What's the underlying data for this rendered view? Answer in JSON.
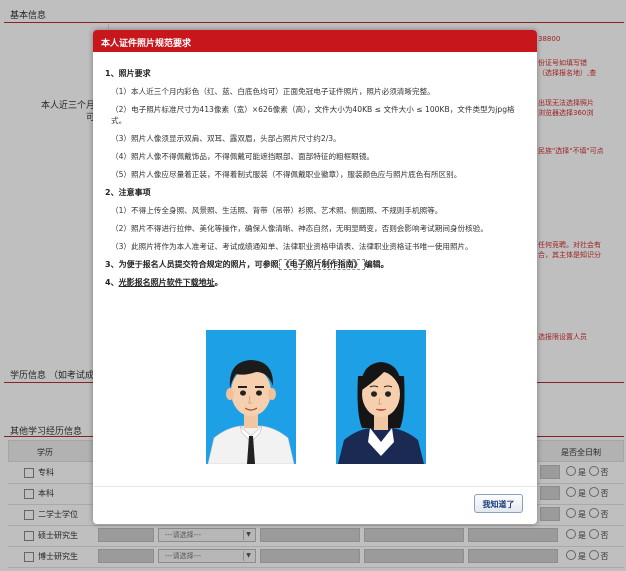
{
  "background": {
    "basic_info_title": "基本信息",
    "photo_label": "本人近三个月内（彩色照片，半身近照，正面免冠，红、蓝、白底色均可）",
    "photo_label_visible": "本人近三个月内",
    "photo_label_line2": "可）",
    "right_texts": [
      "38800",
      "份证号如填写错",
      "（选择报名地）,查",
      "出现无法选择照片",
      "浏览器选择360浏",
      "民族\"选择\"不填\"可点",
      "任何竞聘。对社会有",
      "合，其主体是知识分",
      "选报限设置人员"
    ],
    "edu_title": "学历信息（如考试成",
    "edu_title_visible": "学历信息 （如考试成",
    "other_title": "其他学习经历信息",
    "table_headers": [
      "学历",
      "是否全日制"
    ],
    "rows": [
      {
        "label": "专科",
        "select": ""
      },
      {
        "label": "本科",
        "select": ""
      },
      {
        "label": "二学士学位",
        "select": ""
      },
      {
        "label": "硕士研究生",
        "select": "---请选择---"
      },
      {
        "label": "博士研究生",
        "select": "---请选择---"
      }
    ],
    "radio_yes": "是",
    "radio_no": "否"
  },
  "modal": {
    "title": "本人证件照片规范要求",
    "s1_title": "1、照片要求",
    "s1_items": [
      "（1）本人近三个月内彩色（红、蓝、白底色均可）正面免冠电子证件照片，照片必须清晰完整。",
      "（2）电子照片标准尺寸为413像素（宽）×626像素（高），文件大小为40KB ≤ 文件大小 ≤ 100KB，文件类型为jpg格式。",
      "（3）照片人像须显示双肩、双耳、露双眉，头部占照片尺寸约2/3。",
      "（4）照片人像不得佩戴饰品，不得佩戴可能遮挡眼部、面部特征的粗框眼镜。",
      "（5）照片人像应尽量着正装，不得着制式服装（不得佩戴职业徽章），服装颜色应与照片底色有所区别。"
    ],
    "s2_title": "2、注意事项",
    "s2_items": [
      "（1）不得上传全身照、风景照、生活照、背带（吊带）衫照、艺术照、侧面照、不规则手机照等。",
      "（2）照片不得进行拉伸、美化等操作，确保人像清晰、神态自然，无明显畸变，否则会影响考试期间身份核验。",
      "（3）此照片将作为本人准考证、考试成绩通知单、法律职业资格申请表、法律职业资格证书唯一使用照片。"
    ],
    "s3_prefix": "3、为便于报名人员提交符合规定的照片，可参照",
    "s3_link": "《电子照片制作指南》",
    "s3_suffix": "编辑。",
    "s4_prefix": "4、",
    "s4_link": "光影报名照片软件下载地址",
    "s4_suffix": "。",
    "ok_button": "我知道了",
    "colors": {
      "header": "#c8161d",
      "photo_bg": "#1ea0e6"
    }
  }
}
